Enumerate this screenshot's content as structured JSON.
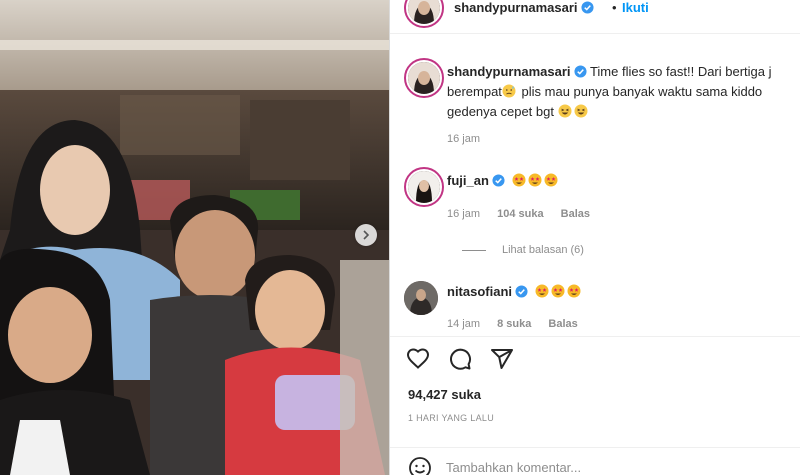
{
  "post": {
    "author": "shandypurnamasari",
    "follow_label": "Ikuti",
    "separator": "•",
    "photo_icon": "carousel-next-icon"
  },
  "caption": {
    "username": "shandypurnamasari",
    "line1": "Time flies so fast!! Dari bertiga j",
    "line2_text": " plis mau punya banyak waktu sama kiddo",
    "line2_start": "berempat",
    "line3": "gedenya cepet bgt",
    "time": "16 jam"
  },
  "comments": [
    {
      "username": "fuji_an",
      "time": "16 jam",
      "likes": "104 suka",
      "reply": "Balas"
    },
    {
      "username": "nitasofiani",
      "time": "14 jam",
      "likes": "8 suka",
      "reply": "Balas"
    }
  ],
  "view_replies": "Lihat balasan (6)",
  "actions": {
    "like_icon": "heart-icon",
    "comment_icon": "comment-icon",
    "share_icon": "share-icon"
  },
  "likes_count": "94,427 suka",
  "post_date": "1 HARI YANG LALU",
  "comment_input": {
    "placeholder": "Tambahkan komentar..."
  },
  "colors": {
    "link_blue": "#0095f6",
    "verified_blue": "#3897f0",
    "story_ring": "#c13584",
    "muted": "#8e8e8e"
  }
}
